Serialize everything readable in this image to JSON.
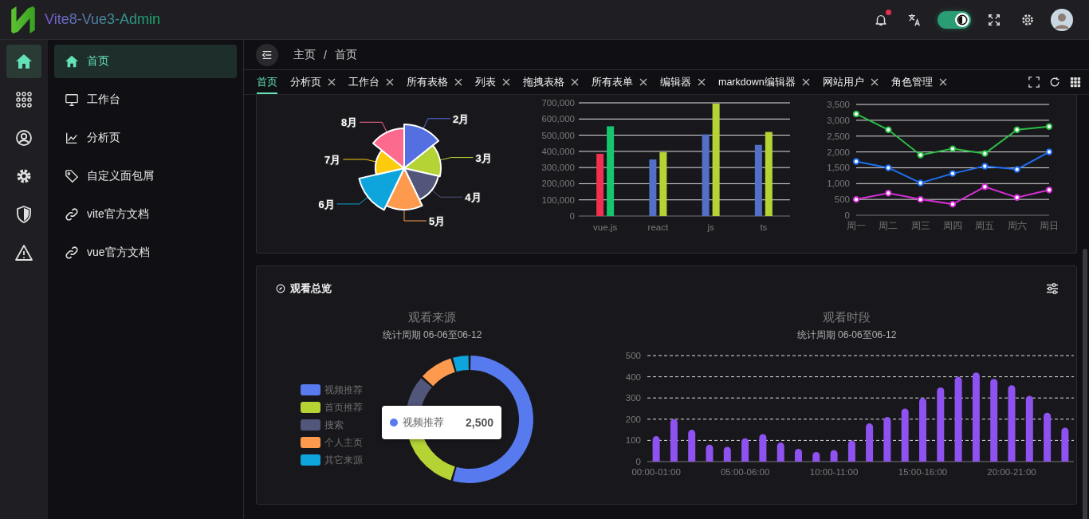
{
  "header": {
    "title": "Vite8-Vue3-Admin",
    "unread": true,
    "theme_switch": {
      "on": true
    }
  },
  "rail": [
    {
      "selected": true
    },
    {
      "selected": false
    },
    {
      "selected": false
    },
    {
      "selected": false
    },
    {
      "selected": false
    },
    {
      "selected": false
    }
  ],
  "sidebar": {
    "items": [
      {
        "label": "首页",
        "selected": true
      },
      {
        "label": "工作台",
        "selected": false
      },
      {
        "label": "分析页",
        "selected": false
      },
      {
        "label": "自定义面包屑",
        "selected": false
      },
      {
        "label": "vite官方文档",
        "selected": false
      },
      {
        "label": "vue官方文档",
        "selected": false
      }
    ]
  },
  "breadcrumb": {
    "items": [
      "主页",
      "首页"
    ],
    "separator": "/"
  },
  "tabs": [
    {
      "label": "首页",
      "selected": true,
      "closable": false
    },
    {
      "label": "分析页",
      "selected": false,
      "closable": true
    },
    {
      "label": "工作台",
      "selected": false,
      "closable": true
    },
    {
      "label": "所有表格",
      "selected": false,
      "closable": true
    },
    {
      "label": "列表",
      "selected": false,
      "closable": true
    },
    {
      "label": "拖拽表格",
      "selected": false,
      "closable": true
    },
    {
      "label": "所有表单",
      "selected": false,
      "closable": true
    },
    {
      "label": "编辑器",
      "selected": false,
      "closable": true
    },
    {
      "label": "markdown编辑器",
      "selected": false,
      "closable": true
    },
    {
      "label": "网站用户",
      "selected": false,
      "closable": true
    },
    {
      "label": "角色管理",
      "selected": false,
      "closable": true
    }
  ],
  "top": {
    "rose": {
      "petals": [
        {
          "label": "2月",
          "color": "#5470e0"
        },
        {
          "label": "3月",
          "color": "#b5d334"
        },
        {
          "label": "4月",
          "color": "#51567a"
        },
        {
          "label": "5月",
          "color": "#fe9a4e"
        },
        {
          "label": "6月",
          "color": "#0ea5dd"
        },
        {
          "label": "7月",
          "color": "#fdcb0e"
        },
        {
          "label": "8月",
          "color": "#fc6a8e"
        }
      ]
    },
    "bar": {
      "chart_data": {
        "type": "bar",
        "categories": [
          "vue.js",
          "react",
          "js",
          "ts"
        ],
        "ylim": [
          0,
          700000
        ],
        "yticks": [
          {
            "value": 0,
            "label": "0"
          },
          {
            "value": 100000,
            "label": "100,000"
          },
          {
            "value": 200000,
            "label": "200,000"
          },
          {
            "value": 300000,
            "label": "300,000"
          },
          {
            "value": 400000,
            "label": "400,000"
          },
          {
            "value": 500000,
            "label": "500,000"
          },
          {
            "value": 600000,
            "label": "600,000"
          },
          {
            "value": 700000,
            "label": "700,000"
          }
        ],
        "grid": true,
        "series": [
          {
            "color": "#f0304e",
            "values": [
              385000,
              null,
              null,
              null
            ]
          },
          {
            "color": "#14c76b",
            "values": [
              555000,
              null,
              null,
              null
            ]
          },
          {
            "color": "#5470c6",
            "values": [
              null,
              350000,
              505000,
              440000
            ]
          },
          {
            "color": "#b5d334",
            "values": [
              null,
              395000,
              695000,
              520000
            ]
          }
        ]
      }
    },
    "line": {
      "chart_data": {
        "type": "line",
        "categories": [
          "周一",
          "周二",
          "周三",
          "周四",
          "周五",
          "周六",
          "周日"
        ],
        "ylim": [
          0,
          3500
        ],
        "yticks": [
          {
            "value": 0,
            "label": "0"
          },
          {
            "value": 500,
            "label": "500"
          },
          {
            "value": 1000,
            "label": "1,000"
          },
          {
            "value": 1500,
            "label": "1,500"
          },
          {
            "value": 2000,
            "label": "2,000"
          },
          {
            "value": 2500,
            "label": "2,500"
          },
          {
            "value": 3000,
            "label": "3,000"
          },
          {
            "value": 3500,
            "label": "3,500"
          }
        ],
        "grid": true,
        "series": [
          {
            "color": "#2dbc46",
            "marker": "circle",
            "values": [
              3200,
              2700,
              1900,
              2100,
              1950,
              2700,
              2800
            ]
          },
          {
            "color": "#1e6ff0",
            "marker": "circle",
            "values": [
              1700,
              1500,
              1020,
              1320,
              1550,
              1450,
              2000
            ]
          },
          {
            "color": "#d42ed4",
            "marker": "circle",
            "values": [
              500,
              700,
              500,
              350,
              900,
              560,
              800
            ]
          }
        ]
      }
    }
  },
  "watch": {
    "title": "观看总览",
    "source": {
      "title": "观看来源",
      "subtitle": "统计周期 06-06至06-12",
      "legend": [
        {
          "label": "视频推荐",
          "color": "#577bef"
        },
        {
          "label": "首页推荐",
          "color": "#b5d334"
        },
        {
          "label": "搜索",
          "color": "#51567a"
        },
        {
          "label": "个人主页",
          "color": "#fe9a4e"
        },
        {
          "label": "其它来源",
          "color": "#0ea5dd"
        }
      ],
      "tooltip": {
        "label": "视频推荐",
        "value": "2,500",
        "color": "#577bef"
      }
    },
    "period": {
      "subtitle": "统计周期 06-06至06-12",
      "chart_data": {
        "type": "bar",
        "title": "观看时段",
        "color": "#8e52f0",
        "grid": true,
        "ylim": [
          0,
          500
        ],
        "yticks": [
          0,
          100,
          200,
          300,
          400,
          500
        ],
        "categories": [
          "00:00-01:00",
          null,
          null,
          null,
          null,
          "05:00-06:00",
          null,
          null,
          null,
          null,
          "10:00-11:00",
          null,
          null,
          null,
          null,
          "15:00-16:00",
          null,
          null,
          null,
          null,
          "20:00-21:00",
          null,
          null,
          null
        ],
        "values": [
          120,
          200,
          150,
          80,
          70,
          110,
          130,
          90,
          60,
          45,
          55,
          100,
          180,
          210,
          250,
          300,
          350,
          400,
          420,
          390,
          360,
          310,
          230,
          160
        ]
      }
    }
  }
}
